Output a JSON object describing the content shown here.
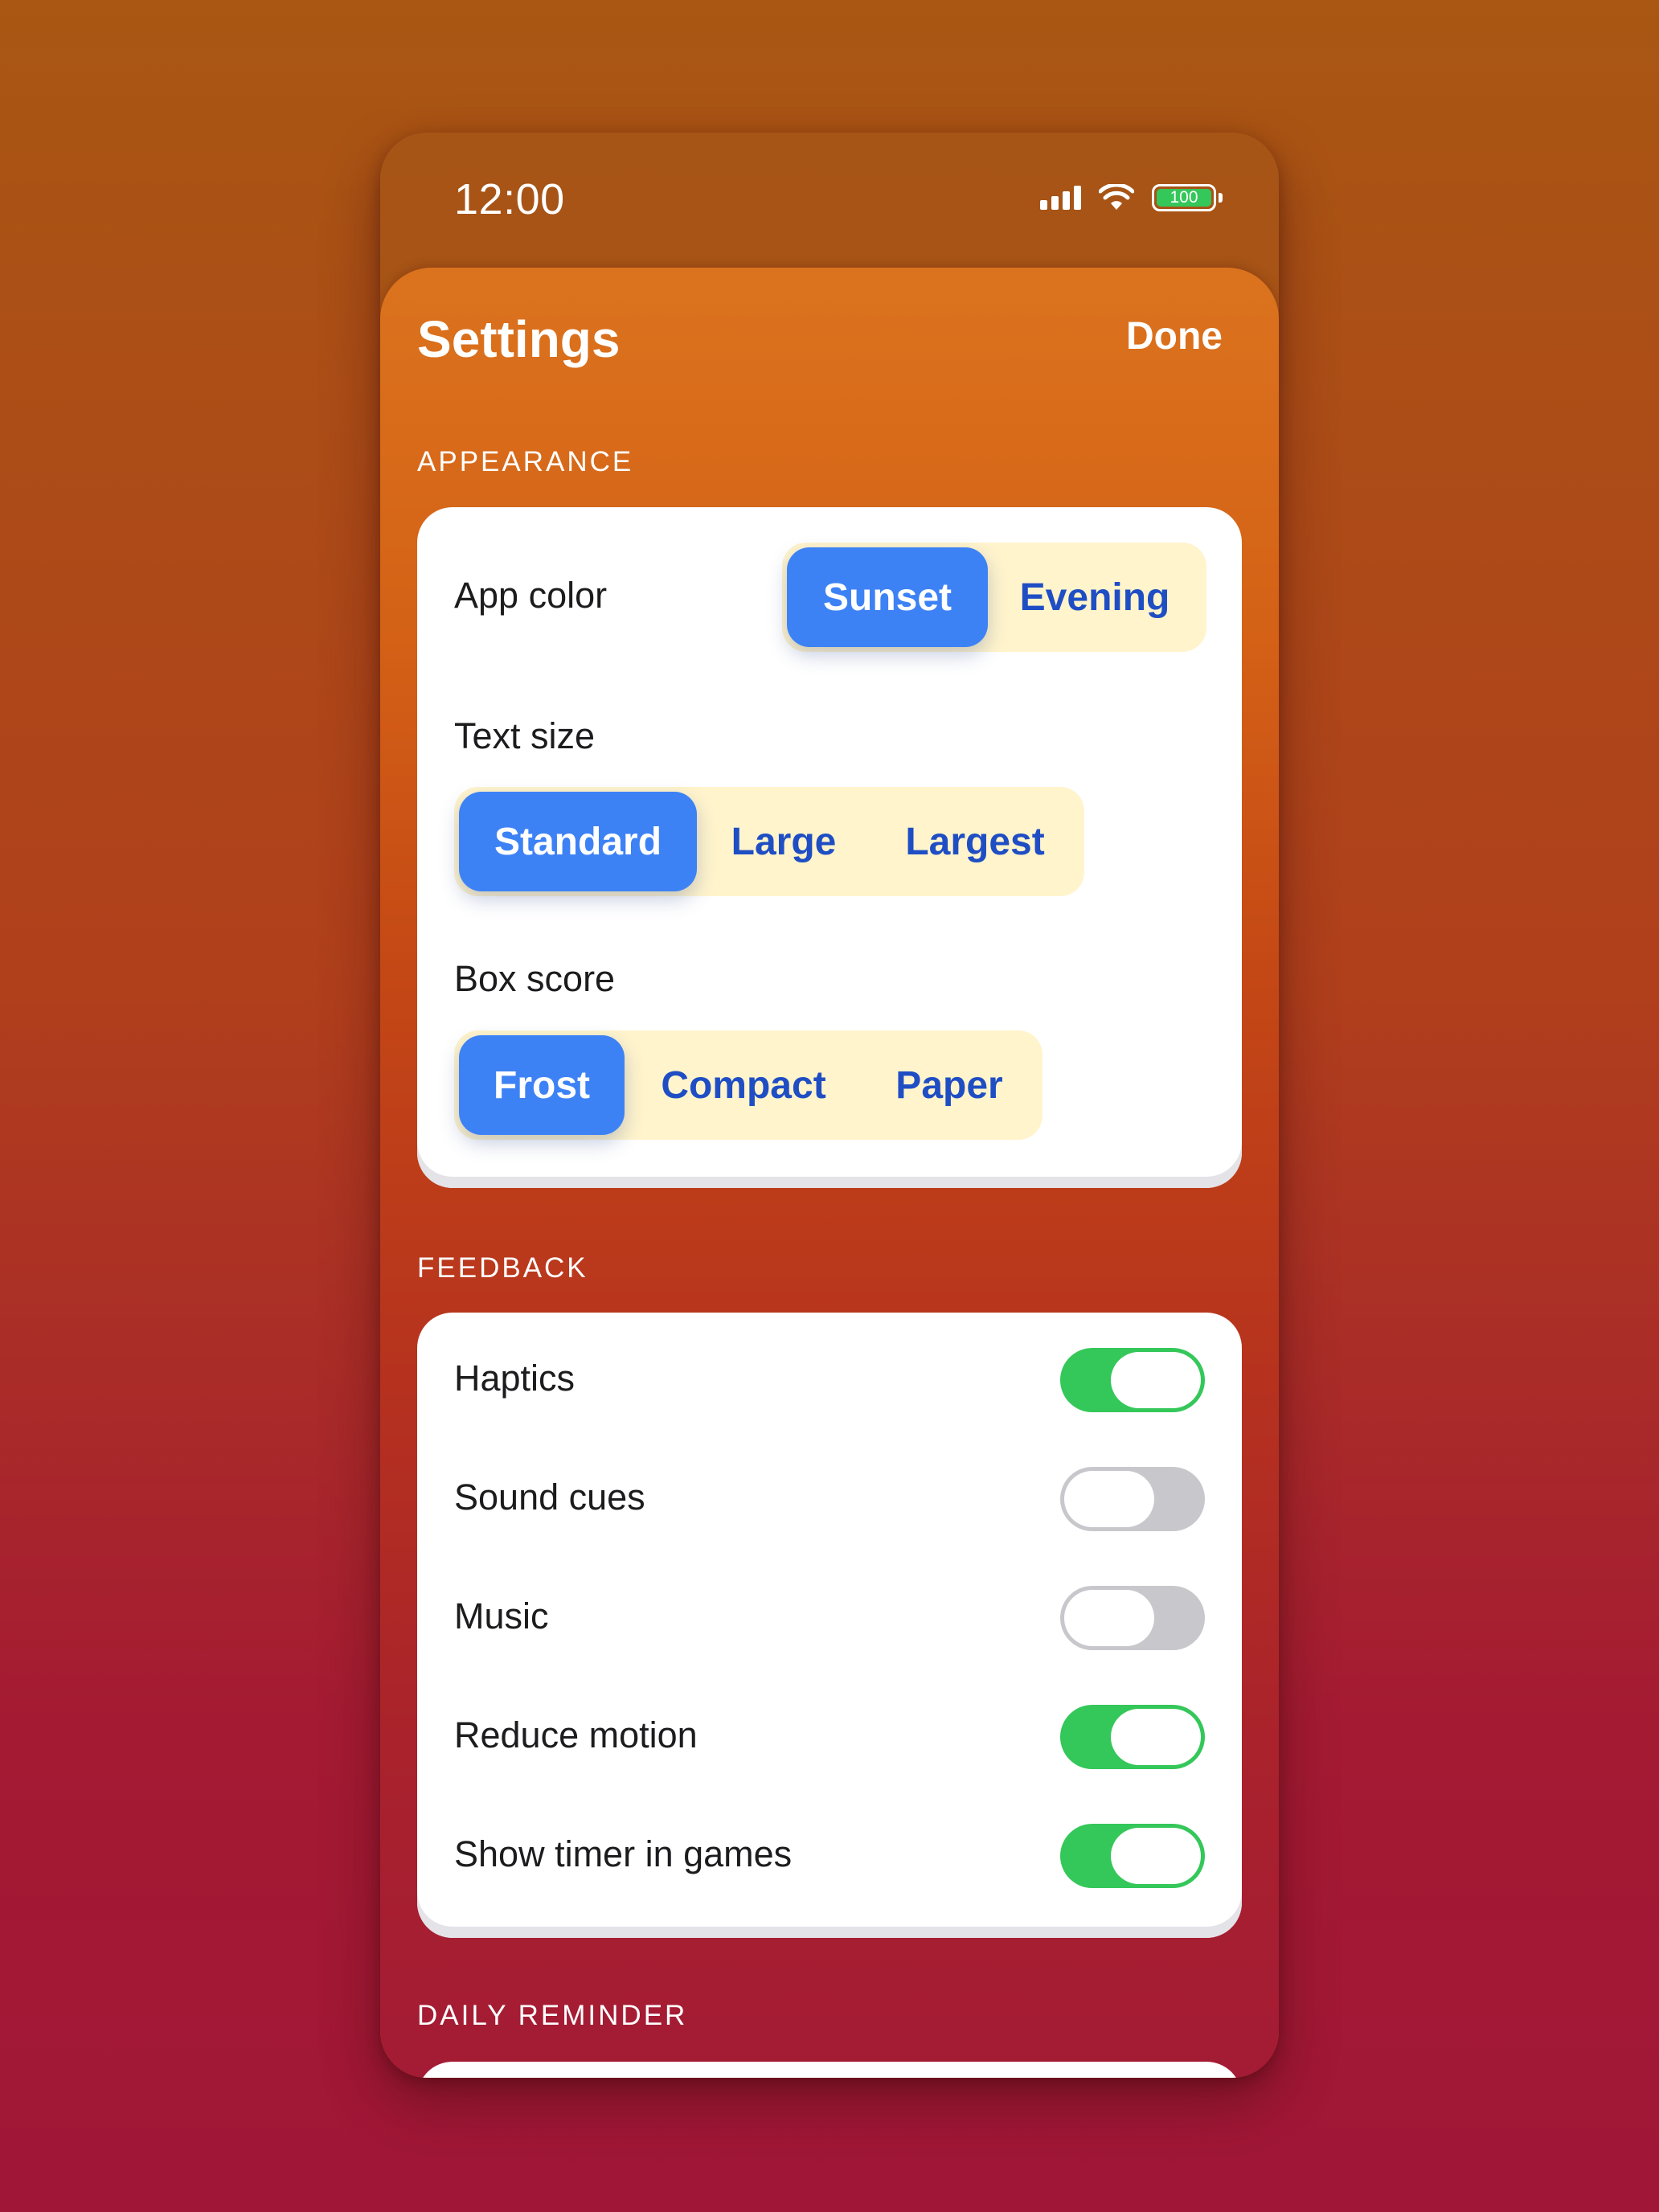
{
  "status_bar": {
    "time": "12:00",
    "battery_level": "100",
    "signal_icon": "cellular-signal-icon",
    "wifi_icon": "wifi-icon",
    "battery_icon": "battery-icon"
  },
  "header": {
    "title": "Settings",
    "done_label": "Done"
  },
  "appearance": {
    "section_title": "APPEARANCE",
    "app_color": {
      "label": "App color",
      "options": [
        "Sunset",
        "Evening"
      ],
      "selected": "Sunset"
    },
    "text_size": {
      "label": "Text size",
      "options": [
        "Standard",
        "Large",
        "Largest"
      ],
      "selected": "Standard"
    },
    "box_score": {
      "label": "Box score",
      "options": [
        "Frost",
        "Compact",
        "Paper"
      ],
      "selected": "Frost"
    }
  },
  "feedback": {
    "section_title": "FEEDBACK",
    "items": [
      {
        "label": "Haptics",
        "on": true
      },
      {
        "label": "Sound cues",
        "on": false
      },
      {
        "label": "Music",
        "on": false
      },
      {
        "label": "Reduce motion",
        "on": true
      },
      {
        "label": "Show timer in games",
        "on": true
      }
    ]
  },
  "daily_reminder": {
    "section_title": "DAILY REMINDER"
  },
  "colors": {
    "accent_blue": "#3D82F5",
    "segment_text": "#1F4EC4",
    "segment_bg": "#FFF4CC",
    "toggle_on": "#34C759",
    "toggle_off": "#C7C7CC"
  }
}
